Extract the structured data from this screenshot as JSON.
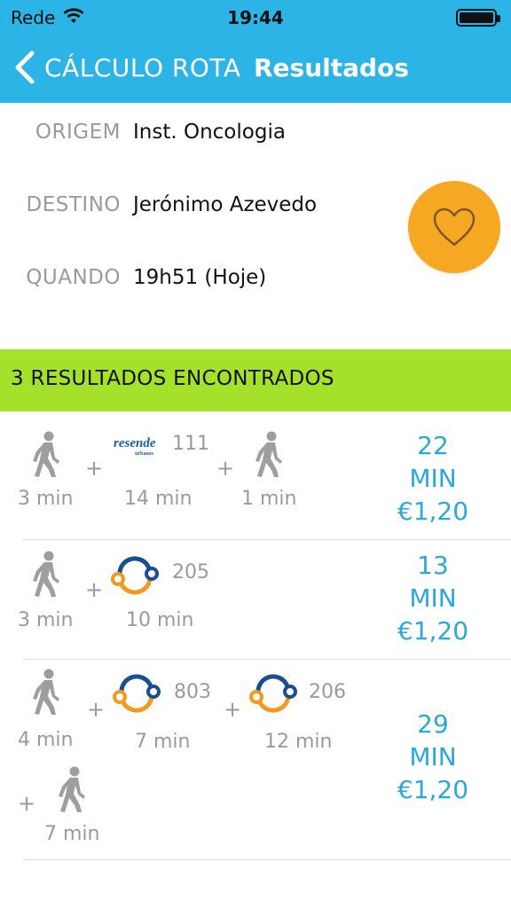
{
  "status_bar": {
    "carrier": "Rede",
    "time": "19:44",
    "wifi_icon": "wifi-icon",
    "battery_icon": "battery-icon"
  },
  "nav": {
    "back_label": "CÁLCULO ROTA",
    "title": "Resultados"
  },
  "query": {
    "origin_label": "ORIGEM",
    "origin_value": "Inst. Oncologia",
    "destination_label": "DESTINO",
    "destination_value": "Jerónimo Azevedo",
    "when_label": "QUANDO",
    "when_value": "19h51 (Hoje)",
    "favorite_icon": "heart-icon"
  },
  "results": {
    "header": "3 RESULTADOS ENCONTRADOS",
    "items": [
      {
        "legs": [
          {
            "type": "walk",
            "duration": "3 min"
          },
          {
            "type": "bus",
            "operator": "resende",
            "operator_sub": "urbanos",
            "line": "111",
            "duration": "14 min"
          },
          {
            "type": "walk",
            "duration": "1 min"
          }
        ],
        "total": "22",
        "unit": "MIN",
        "price": "€1,20"
      },
      {
        "legs": [
          {
            "type": "walk",
            "duration": "3 min"
          },
          {
            "type": "bus",
            "operator": "stcp",
            "line": "205",
            "duration": "10 min"
          }
        ],
        "total": "13",
        "unit": "MIN",
        "price": "€1,20"
      },
      {
        "legs": [
          {
            "type": "walk",
            "duration": "4 min"
          },
          {
            "type": "bus",
            "operator": "stcp",
            "line": "803",
            "duration": "7 min"
          },
          {
            "type": "bus",
            "operator": "stcp",
            "line": "206",
            "duration": "12 min"
          },
          {
            "type": "walk",
            "duration": "7 min"
          }
        ],
        "total": "29",
        "unit": "MIN",
        "price": "€1,20"
      }
    ],
    "plus_symbol": "+"
  },
  "colors": {
    "header_blue": "#2db4e6",
    "results_green": "#a5e12b",
    "favorite_orange": "#f6a823",
    "accent_text_blue": "#2aa8dc",
    "bus_blue": "#1a4e92",
    "bus_orange": "#f29a1f"
  }
}
